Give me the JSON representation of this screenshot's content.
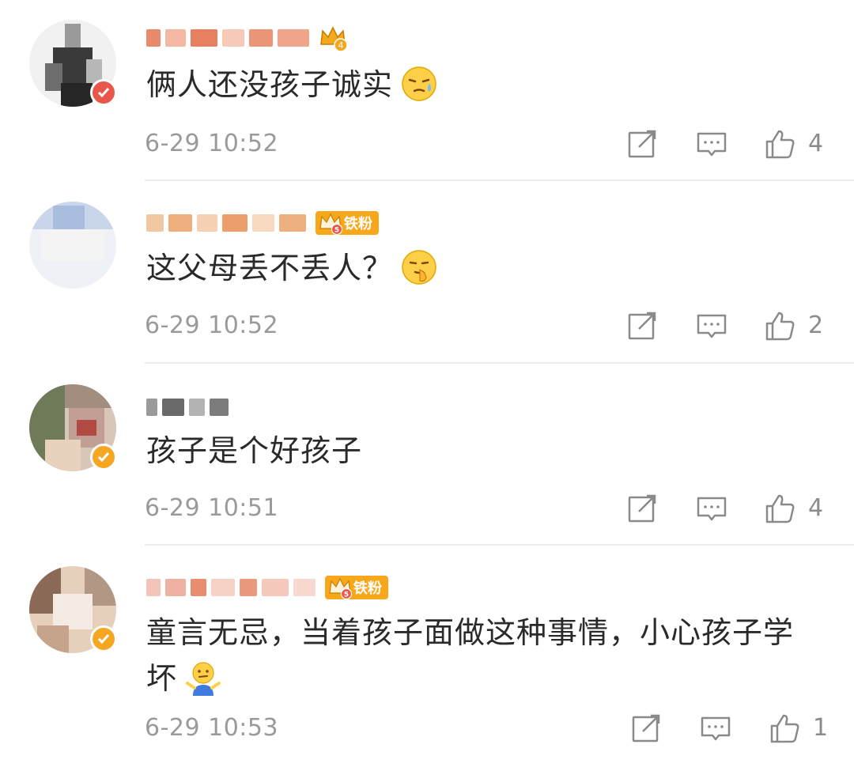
{
  "comments": [
    {
      "text": "俩人还没孩子诚实",
      "emoji": "sweat-face-emoji",
      "crown_level": "4",
      "fan_badge": "",
      "time": "6-29 10:52",
      "likes": "4",
      "badge_color": "#e8574a"
    },
    {
      "text": "这父母丢不丢人？",
      "emoji": "shush-face-emoji",
      "crown_level": "5",
      "fan_badge": "铁粉",
      "time": "6-29 10:52",
      "likes": "2",
      "badge_color": ""
    },
    {
      "text": "孩子是个好孩子",
      "emoji": "",
      "crown_level": "",
      "fan_badge": "",
      "time": "6-29 10:51",
      "likes": "4",
      "badge_color": "#f5a623"
    },
    {
      "text": "童言无忌，当着孩子面做这种事情，小心孩子学坏",
      "emoji": "shrug-person-emoji",
      "crown_level": "5",
      "fan_badge": "铁粉",
      "time": "6-29 10:53",
      "likes": "1",
      "badge_color": "#f5a623"
    }
  ],
  "icons": {
    "share": "share-icon",
    "reply": "comment-icon",
    "like": "thumbs-up-icon"
  },
  "colors": {
    "accent": "#f5a623",
    "meta": "#9a9a9a",
    "divider": "#ececec"
  }
}
